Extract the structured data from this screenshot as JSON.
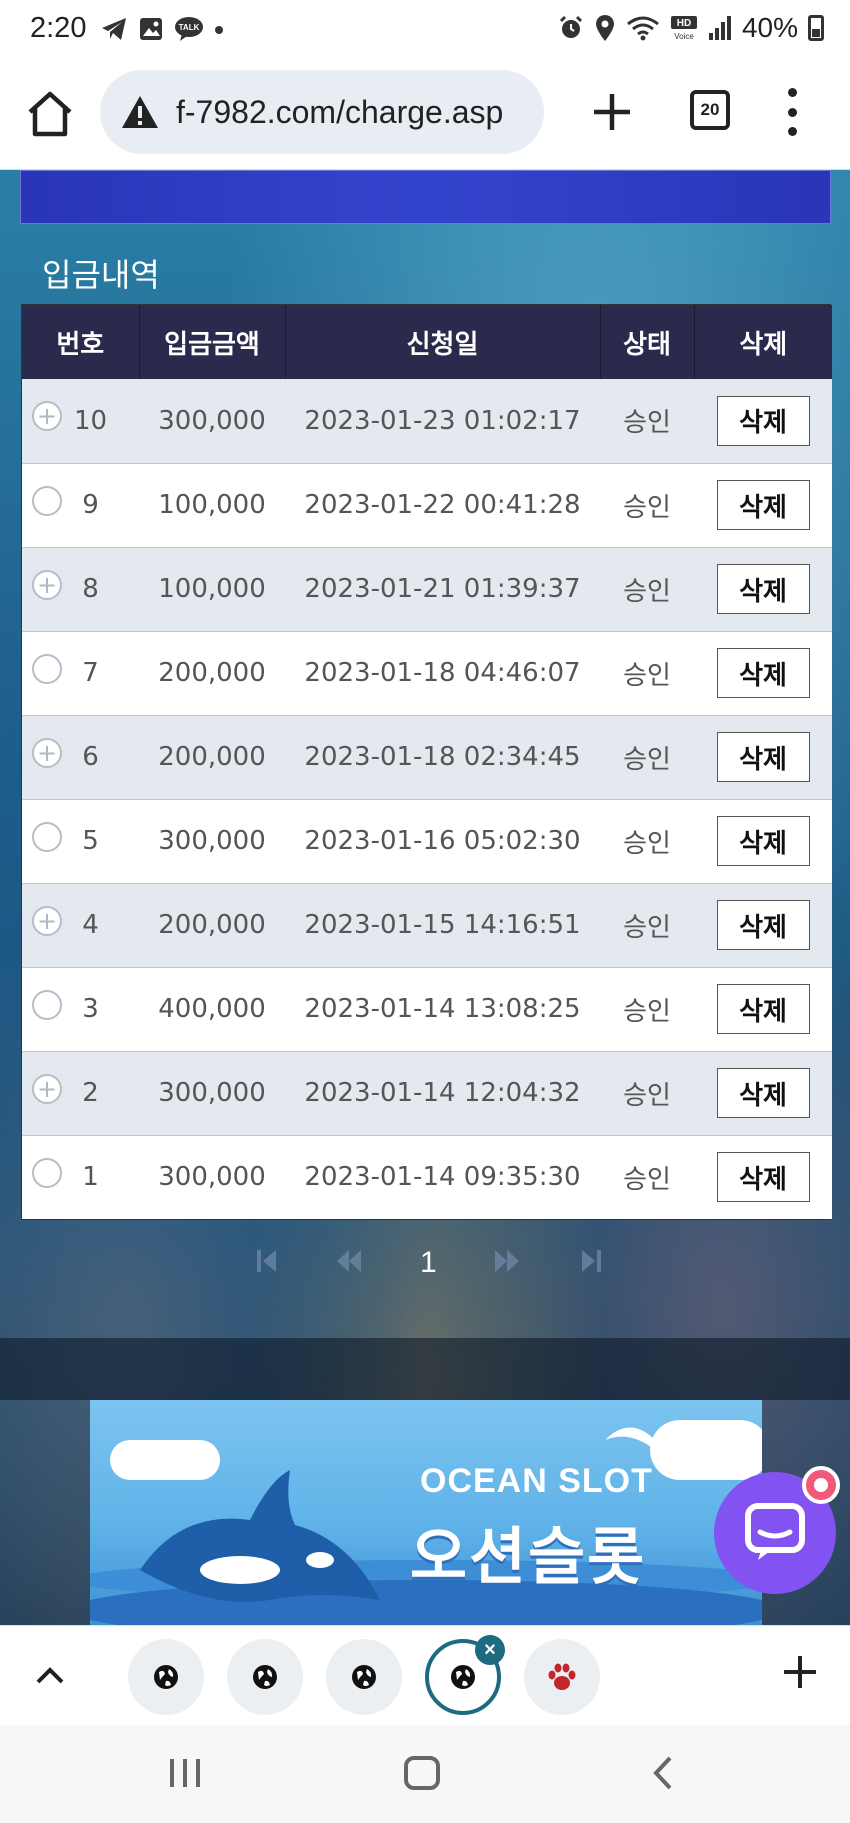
{
  "status_bar": {
    "time": "2:20",
    "battery": "40%",
    "icons": [
      "telegram-icon",
      "gallery-icon",
      "talk-icon",
      "dot-icon",
      "alarm-icon",
      "location-icon",
      "wifi-icon",
      "hd-voice-icon",
      "signal-icon",
      "battery-icon"
    ]
  },
  "browser": {
    "url": "f-7982.com/charge.asp",
    "tab_count": "20"
  },
  "page": {
    "section_title": "입금내역",
    "table": {
      "headers": [
        "번호",
        "입금금액",
        "신청일",
        "상태",
        "삭제"
      ],
      "rows": [
        {
          "no": "10",
          "amount": "300,000",
          "date": "2023-01-23 01:02:17",
          "status": "승인",
          "delete": "삭제"
        },
        {
          "no": "9",
          "amount": "100,000",
          "date": "2023-01-22 00:41:28",
          "status": "승인",
          "delete": "삭제"
        },
        {
          "no": "8",
          "amount": "100,000",
          "date": "2023-01-21 01:39:37",
          "status": "승인",
          "delete": "삭제"
        },
        {
          "no": "7",
          "amount": "200,000",
          "date": "2023-01-18 04:46:07",
          "status": "승인",
          "delete": "삭제"
        },
        {
          "no": "6",
          "amount": "200,000",
          "date": "2023-01-18 02:34:45",
          "status": "승인",
          "delete": "삭제"
        },
        {
          "no": "5",
          "amount": "300,000",
          "date": "2023-01-16 05:02:30",
          "status": "승인",
          "delete": "삭제"
        },
        {
          "no": "4",
          "amount": "200,000",
          "date": "2023-01-15 14:16:51",
          "status": "승인",
          "delete": "삭제"
        },
        {
          "no": "3",
          "amount": "400,000",
          "date": "2023-01-14 13:08:25",
          "status": "승인",
          "delete": "삭제"
        },
        {
          "no": "2",
          "amount": "300,000",
          "date": "2023-01-14 12:04:32",
          "status": "승인",
          "delete": "삭제"
        },
        {
          "no": "1",
          "amount": "300,000",
          "date": "2023-01-14 09:35:30",
          "status": "승인",
          "delete": "삭제"
        }
      ]
    },
    "pagination": {
      "current_page": "1",
      "first_icon": "first-page-icon",
      "prev_icon": "prev-page-icon",
      "next_icon": "next-page-icon",
      "last_icon": "last-page-icon"
    },
    "ad": {
      "title_en": "OCEAN SLOT",
      "title_ko": "오션슬롯"
    },
    "chat_icon": "chat-bubble-icon"
  },
  "tab_strip": {
    "tabs": [
      "globe-icon",
      "globe-icon",
      "globe-icon",
      "globe-icon",
      "paw-icon"
    ],
    "active_index": 3
  },
  "colors": {
    "header_bg": "#2b2a4c",
    "banner_blue": "#2a35b8",
    "chat_purple": "#8353f2",
    "active_tab": "#1e6a80"
  }
}
